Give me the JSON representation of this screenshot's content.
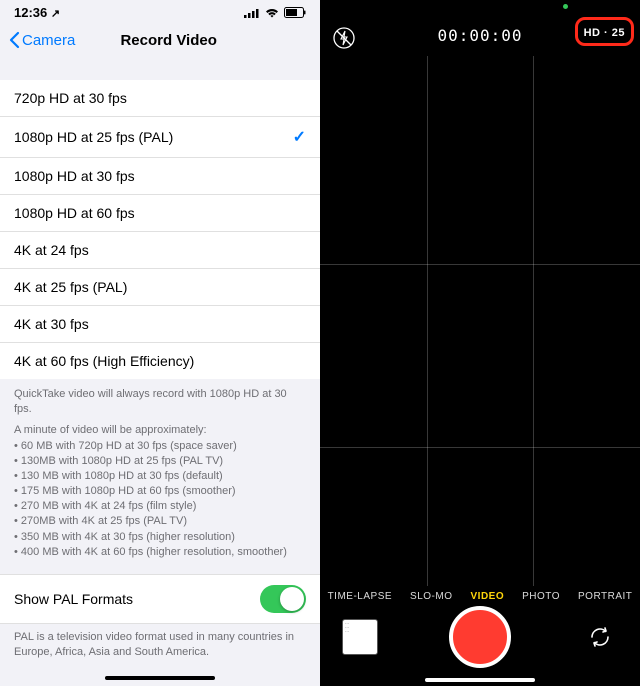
{
  "left": {
    "status": {
      "time": "12:36",
      "location_arrow": "↗"
    },
    "nav": {
      "back_label": "Camera",
      "title": "Record Video"
    },
    "options": [
      {
        "label": "720p HD at 30 fps",
        "selected": false
      },
      {
        "label": "1080p HD at 25 fps (PAL)",
        "selected": true
      },
      {
        "label": "1080p HD at 30 fps",
        "selected": false
      },
      {
        "label": "1080p HD at 60 fps",
        "selected": false
      },
      {
        "label": "4K at 24 fps",
        "selected": false
      },
      {
        "label": "4K at 25 fps (PAL)",
        "selected": false
      },
      {
        "label": "4K at 30 fps",
        "selected": false
      },
      {
        "label": "4K at 60 fps (High Efficiency)",
        "selected": false
      }
    ],
    "footer": {
      "quicktake": "QuickTake video will always record with 1080p HD at 30 fps.",
      "lead": "A minute of video will be approximately:",
      "sizes": [
        "60 MB with 720p HD at 30 fps (space saver)",
        "130MB with 1080p HD at 25 fps (PAL TV)",
        "130 MB with 1080p HD at 30 fps (default)",
        "175 MB with 1080p HD at 60 fps (smoother)",
        "270 MB with 4K at 24 fps (film style)",
        "270MB with 4K at 25 fps (PAL TV)",
        "350 MB with 4K at 30 fps (higher resolution)",
        "400 MB with 4K at 60 fps (higher resolution, smoother)"
      ]
    },
    "pal": {
      "label": "Show PAL Formats",
      "on": true,
      "desc": "PAL is a television video format used in many countries in Europe, Africa, Asia and South America."
    }
  },
  "right": {
    "timer": "00:00:00",
    "badge": "HD  ·  25",
    "modes": [
      {
        "label": "TIME-LAPSE",
        "active": false
      },
      {
        "label": "SLO-MO",
        "active": false
      },
      {
        "label": "VIDEO",
        "active": true
      },
      {
        "label": "PHOTO",
        "active": false
      },
      {
        "label": "PORTRAIT",
        "active": false
      }
    ]
  }
}
